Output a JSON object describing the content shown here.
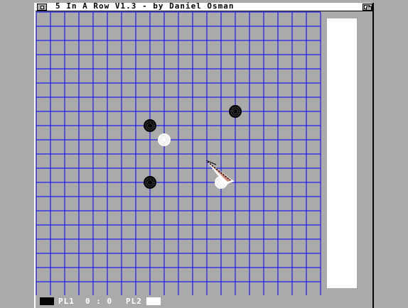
{
  "window": {
    "title": "5 In A Row V1.3 - by Daniel Osman"
  },
  "board": {
    "columns": 20,
    "rows": 20,
    "line_color": "#0000ff",
    "stones": [
      {
        "col": 14,
        "row": 7,
        "color": "black"
      },
      {
        "col": 8,
        "row": 8,
        "color": "black"
      },
      {
        "col": 9,
        "row": 9,
        "color": "white"
      },
      {
        "col": 8,
        "row": 12,
        "color": "black"
      },
      {
        "col": 13,
        "row": 12,
        "color": "white"
      }
    ]
  },
  "status": {
    "player1_label": "PL1",
    "score_text": "0 : 0",
    "player2_label": "PL2",
    "player1_color": "#000000",
    "player2_color": "#ffffff"
  },
  "pointer_icon": "amiga-mouse-pointer-icon"
}
